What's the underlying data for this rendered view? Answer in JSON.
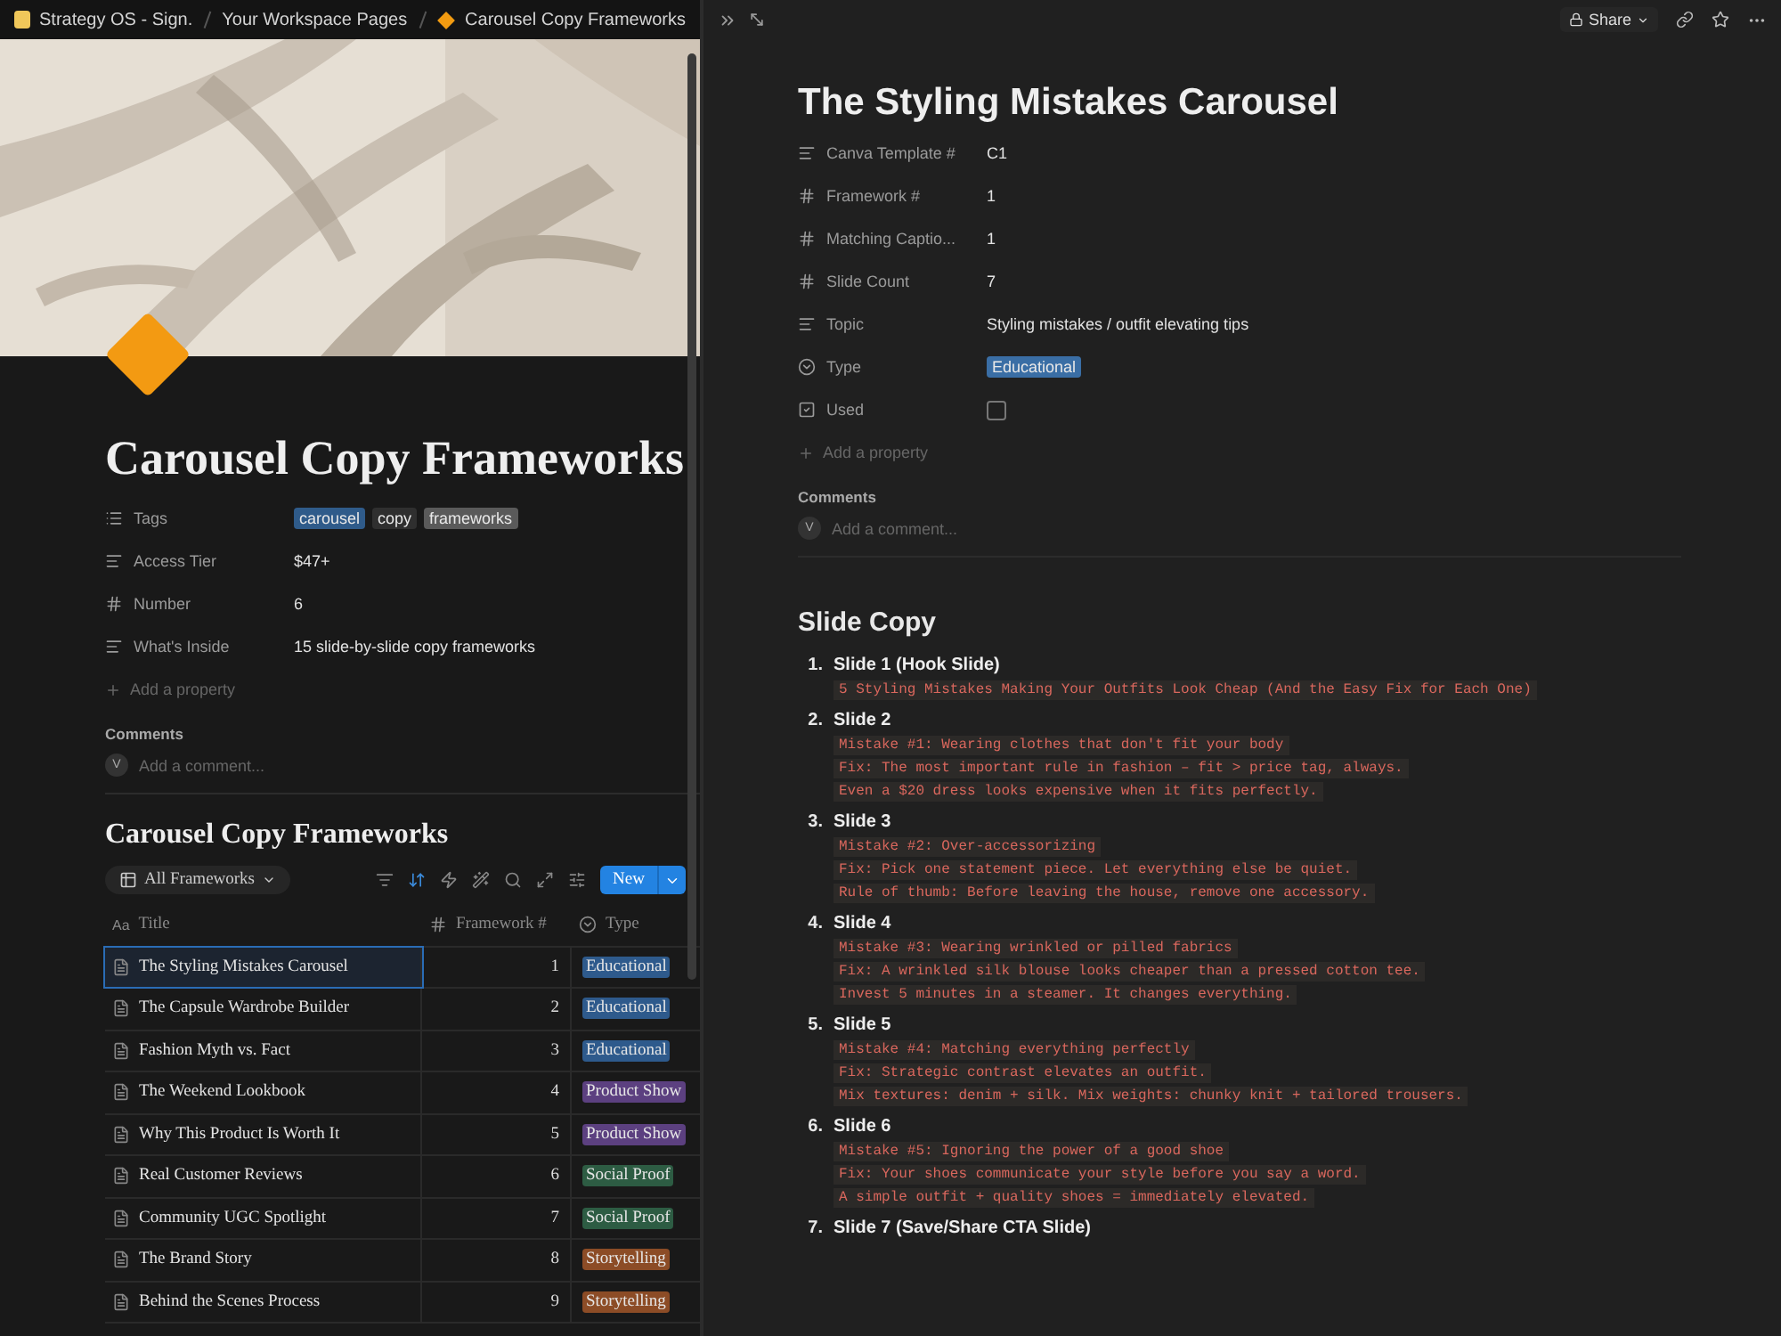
{
  "breadcrumb": [
    {
      "label": "Strategy OS - Sign.",
      "kind": "workspace"
    },
    {
      "label": "Your Workspace Pages",
      "kind": "plain"
    },
    {
      "label": "Carousel Copy Frameworks",
      "kind": "diamond"
    }
  ],
  "left_page": {
    "title": "Carousel Copy Frameworks",
    "properties": [
      {
        "label": "Tags",
        "kind": "tags",
        "tags": [
          {
            "label": "carousel",
            "color": "#2f5b8a"
          },
          {
            "label": "copy",
            "color": "#2f2f2f"
          },
          {
            "label": "frameworks",
            "color": "#5a5a5a"
          }
        ]
      },
      {
        "label": "Access Tier",
        "kind": "text",
        "value": "$47+"
      },
      {
        "label": "Number",
        "kind": "number",
        "value": "6"
      },
      {
        "label": "What's Inside",
        "kind": "text",
        "value": "15 slide-by-slide copy frameworks"
      }
    ],
    "add_property": "Add a property",
    "comments": {
      "heading": "Comments",
      "avatar": "V",
      "placeholder": "Add a comment..."
    },
    "database": {
      "title": "Carousel Copy Frameworks",
      "view": "All Frameworks",
      "new_button": "New",
      "columns": [
        {
          "label": "Title",
          "kind": "title",
          "glyph": "Aa"
        },
        {
          "label": "Framework #",
          "kind": "number"
        },
        {
          "label": "Type",
          "kind": "select"
        }
      ],
      "rows": [
        {
          "title": "The Styling Mistakes Carousel",
          "number": "1",
          "type": "Educational",
          "color": "#2e5a8c",
          "selected": true
        },
        {
          "title": "The Capsule Wardrobe Builder",
          "number": "2",
          "type": "Educational",
          "color": "#2e5a8c",
          "selected": false
        },
        {
          "title": "Fashion Myth vs. Fact",
          "number": "3",
          "type": "Educational",
          "color": "#2e5a8c",
          "selected": false
        },
        {
          "title": "The Weekend Lookbook",
          "number": "4",
          "type": "Product Show",
          "color": "#5c4080",
          "selected": false
        },
        {
          "title": "Why This Product Is Worth It",
          "number": "5",
          "type": "Product Show",
          "color": "#5c4080",
          "selected": false
        },
        {
          "title": "Real Customer Reviews",
          "number": "6",
          "type": "Social Proof",
          "color": "#2d5c43",
          "selected": false
        },
        {
          "title": "Community UGC Spotlight",
          "number": "7",
          "type": "Social Proof",
          "color": "#2d5c43",
          "selected": false
        },
        {
          "title": "The Brand Story",
          "number": "8",
          "type": "Storytelling",
          "color": "#8c4c26",
          "selected": false
        },
        {
          "title": "Behind the Scenes Process",
          "number": "9",
          "type": "Storytelling",
          "color": "#8c4c26",
          "selected": false
        }
      ]
    }
  },
  "right_page": {
    "share": "Share",
    "title": "The Styling Mistakes Carousel",
    "properties": [
      {
        "label": "Canva Template #",
        "kind": "text",
        "value": "C1"
      },
      {
        "label": "Framework #",
        "kind": "number",
        "value": "1"
      },
      {
        "label": "Matching Captio...",
        "kind": "number",
        "value": "1"
      },
      {
        "label": "Slide Count",
        "kind": "number",
        "value": "7"
      },
      {
        "label": "Topic",
        "kind": "text",
        "value": "Styling mistakes / outfit elevating tips"
      },
      {
        "label": "Type",
        "kind": "select",
        "value": "Educational",
        "color": "#3a6ea5"
      },
      {
        "label": "Used",
        "kind": "checkbox",
        "checked": false
      }
    ],
    "add_property": "Add a property",
    "comments": {
      "heading": "Comments",
      "avatar": "V",
      "placeholder": "Add a comment..."
    },
    "section_heading": "Slide Copy",
    "slides": [
      {
        "number": "1.",
        "title": "Slide 1 (Hook Slide)",
        "lines": [
          "5 Styling Mistakes Making Your Outfits Look Cheap (And the Easy Fix for Each One)"
        ]
      },
      {
        "number": "2.",
        "title": "Slide 2",
        "lines": [
          "Mistake #1: Wearing clothes that don't fit your body",
          "Fix: The most important rule in fashion – fit > price tag, always.",
          "Even a $20 dress looks expensive when it fits perfectly."
        ]
      },
      {
        "number": "3.",
        "title": "Slide 3",
        "lines": [
          "Mistake #2: Over-accessorizing",
          "Fix: Pick one statement piece. Let everything else be quiet.",
          "Rule of thumb: Before leaving the house, remove one accessory."
        ]
      },
      {
        "number": "4.",
        "title": "Slide 4",
        "lines": [
          "Mistake #3: Wearing wrinkled or pilled fabrics",
          "Fix: A wrinkled silk blouse looks cheaper than a pressed cotton tee.",
          "Invest 5 minutes in a steamer. It changes everything."
        ]
      },
      {
        "number": "5.",
        "title": "Slide 5",
        "lines": [
          "Mistake #4: Matching everything perfectly",
          "Fix: Strategic contrast elevates an outfit.",
          "Mix textures: denim + silk. Mix weights: chunky knit + tailored trousers."
        ]
      },
      {
        "number": "6.",
        "title": "Slide 6",
        "lines": [
          "Mistake #5: Ignoring the power of a good shoe",
          "Fix: Your shoes communicate your style before you say a word.",
          "A simple outfit + quality shoes = immediately elevated."
        ]
      },
      {
        "number": "7.",
        "title": "Slide 7 (Save/Share CTA Slide)"
      }
    ]
  }
}
